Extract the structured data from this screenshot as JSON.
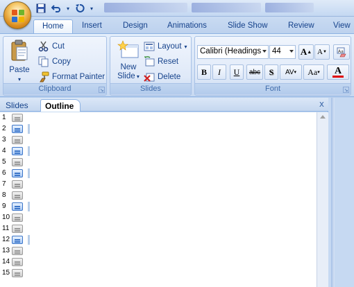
{
  "qat": {
    "save_icon": "save-icon",
    "undo_icon": "undo-icon",
    "redo_icon": "redo-icon",
    "customize_icon": "customize-qat-icon"
  },
  "tabs": [
    {
      "label": "Home",
      "active": true
    },
    {
      "label": "Insert"
    },
    {
      "label": "Design"
    },
    {
      "label": "Animations"
    },
    {
      "label": "Slide Show"
    },
    {
      "label": "Review"
    },
    {
      "label": "View"
    }
  ],
  "clipboard": {
    "paste": "Paste",
    "cut": "Cut",
    "copy": "Copy",
    "format_painter": "Format Painter",
    "label": "Clipboard"
  },
  "slides_group": {
    "new_slide_line1": "New",
    "new_slide_line2": "Slide",
    "layout": "Layout",
    "reset": "Reset",
    "delete": "Delete",
    "label": "Slides"
  },
  "font_group": {
    "font_name": "Calibri (Headings",
    "font_size": "44",
    "label": "Font",
    "bold": "B",
    "italic": "I",
    "underline": "U",
    "strike": "abc",
    "shadow": "S",
    "spacing": "AV",
    "case": "Aa",
    "grow": "A",
    "shrink": "A",
    "color": "A"
  },
  "pane": {
    "tabs": [
      {
        "label": "Slides"
      },
      {
        "label": "Outline",
        "active": true
      }
    ],
    "close": "x",
    "rows": [
      {
        "n": "1",
        "sel": false
      },
      {
        "n": "2",
        "sel": true
      },
      {
        "n": "3",
        "sel": false
      },
      {
        "n": "4",
        "sel": true
      },
      {
        "n": "5",
        "sel": false
      },
      {
        "n": "6",
        "sel": true
      },
      {
        "n": "7",
        "sel": false
      },
      {
        "n": "8",
        "sel": false
      },
      {
        "n": "9",
        "sel": true
      },
      {
        "n": "10",
        "sel": false
      },
      {
        "n": "11",
        "sel": false
      },
      {
        "n": "12",
        "sel": true
      },
      {
        "n": "13",
        "sel": false
      },
      {
        "n": "14",
        "sel": false
      },
      {
        "n": "15",
        "sel": false
      }
    ]
  },
  "colors": {
    "accent": "#15428b",
    "ribbon_bg": "#dfe9f8",
    "selection": "#3a74c8",
    "font_color_bar": "#e00000"
  }
}
